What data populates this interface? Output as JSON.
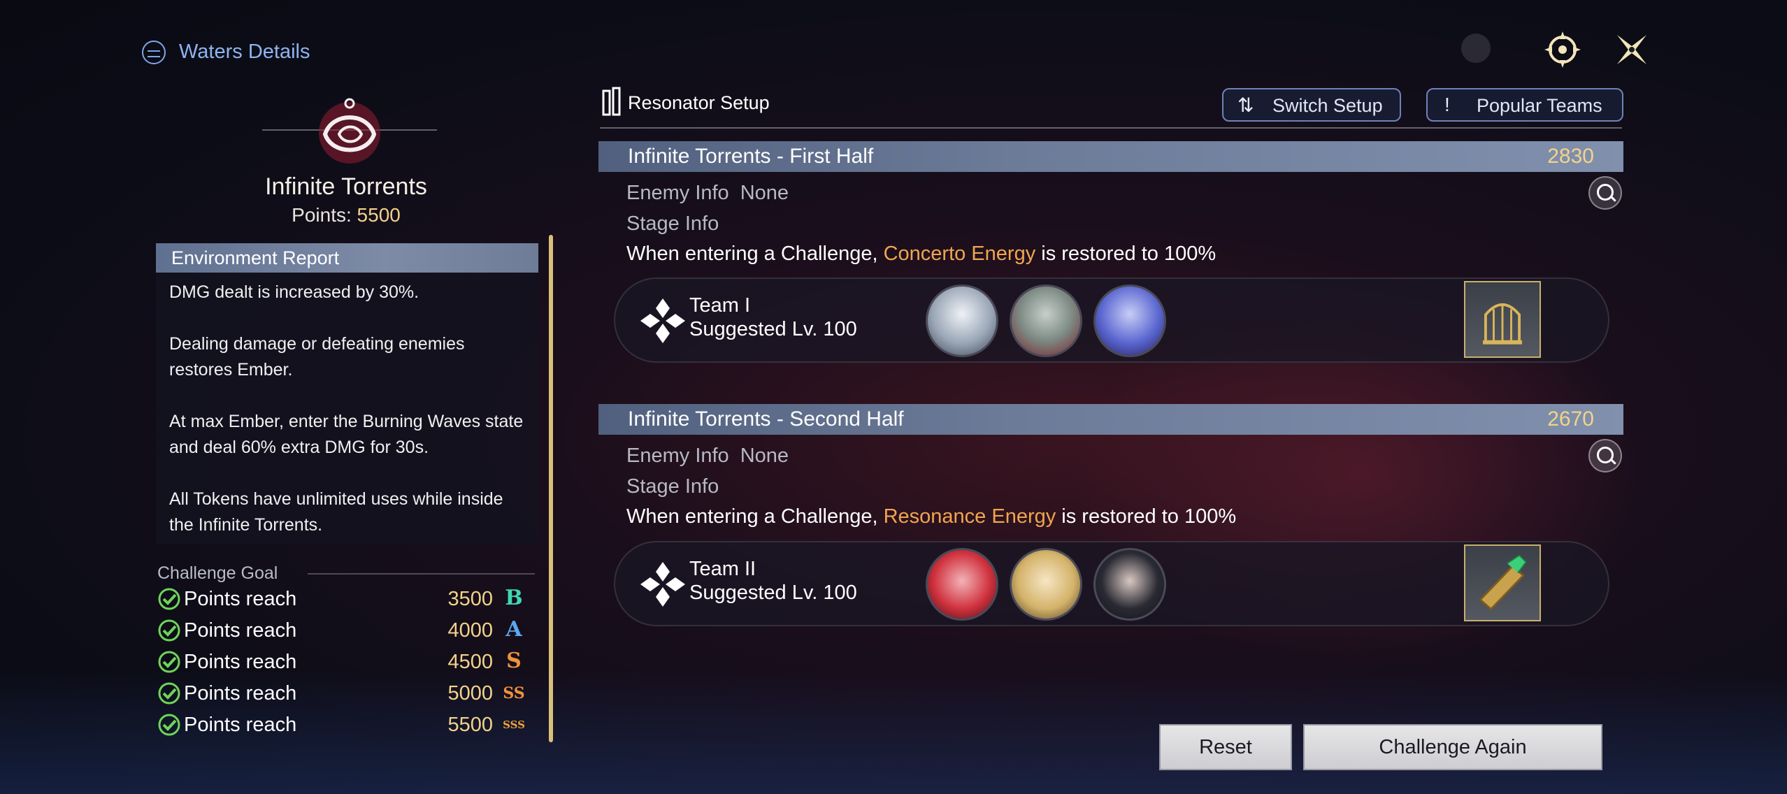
{
  "header": {
    "title": "Waters Details"
  },
  "stage": {
    "name": "Infinite Torrents",
    "points_label": "Points:",
    "points_value": "5500"
  },
  "environment": {
    "heading": "Environment Report",
    "text": "DMG dealt is increased by 30%.\n\nDealing damage or defeating enemies restores Ember.\n\nAt max Ember, enter the Burning Waves state and deal 60% extra DMG for 30s.\n\nAll Tokens have unlimited uses while inside the Infinite Torrents."
  },
  "challenge_goal": {
    "heading": "Challenge Goal",
    "rows": [
      {
        "label": "Points reach",
        "value": "3500",
        "rank": "B",
        "rank_color": "#3fd7b4"
      },
      {
        "label": "Points reach",
        "value": "4000",
        "rank": "A",
        "rank_color": "#5aa8f0"
      },
      {
        "label": "Points reach",
        "value": "4500",
        "rank": "S",
        "rank_color": "#f0923c"
      },
      {
        "label": "Points reach",
        "value": "5000",
        "rank": "SS",
        "rank_color": "#f0923c"
      },
      {
        "label": "Points reach",
        "value": "5500",
        "rank": "SSS",
        "rank_color": "#f0a23c"
      }
    ]
  },
  "setup": {
    "title": "Resonator Setup",
    "switch_label": "Switch Setup",
    "popular_label": "Popular Teams"
  },
  "halves": [
    {
      "name": "Infinite Torrents - First Half",
      "score": "2830",
      "enemy_label": "Enemy Info",
      "enemy_value": "None",
      "stage_label": "Stage Info",
      "desc_before": "When entering a Challenge, ",
      "desc_highlight": "Concerto Energy",
      "desc_after": " is restored to 100%",
      "team_name": "Team I",
      "team_level": "Suggested Lv. 100"
    },
    {
      "name": "Infinite Torrents - Second Half",
      "score": "2670",
      "enemy_label": "Enemy Info",
      "enemy_value": "None",
      "stage_label": "Stage Info",
      "desc_before": "When entering a Challenge, ",
      "desc_highlight": "Resonance Energy",
      "desc_after": " is restored to 100%",
      "team_name": "Team II",
      "team_level": "Suggested Lv. 100"
    }
  ],
  "buttons": {
    "reset": "Reset",
    "challenge_again": "Challenge Again"
  },
  "icons": [
    "globe-icon",
    "settings-compass-icon",
    "close-icon",
    "search-icon",
    "check-icon",
    "team-emblem-icon",
    "switch-icon",
    "exclamation-icon"
  ]
}
